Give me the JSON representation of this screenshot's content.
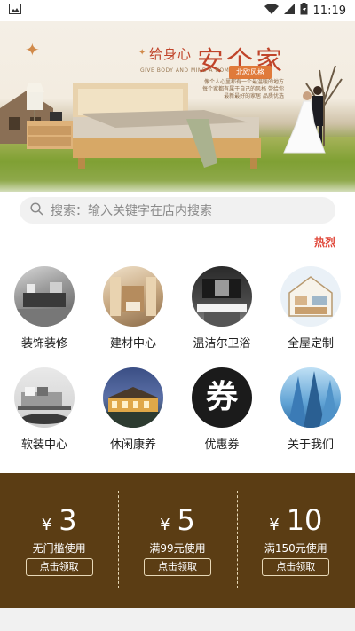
{
  "status_bar": {
    "time": "11:19"
  },
  "banner": {
    "title_prefix": "给身心",
    "title_main": "安个家",
    "subtitle": "GIVE BODY AND MIND A HOME",
    "tag": "北欧风格",
    "desc": "像个人心里都有一个最温暖的地方 每个家都有属于自己的风格 带给你最新最好的家居 品质优选"
  },
  "search": {
    "placeholder": "搜索：输入关键字在店内搜索"
  },
  "hot_label": "热烈",
  "categories": [
    {
      "label": "装饰装修",
      "icon": "decoration-icon"
    },
    {
      "label": "建材中心",
      "icon": "building-materials-icon"
    },
    {
      "label": "温洁尔卫浴",
      "icon": "bathroom-icon"
    },
    {
      "label": "全屋定制",
      "icon": "custom-home-icon"
    },
    {
      "label": "软装中心",
      "icon": "soft-furnishing-icon"
    },
    {
      "label": "休闲康养",
      "icon": "leisure-icon"
    },
    {
      "label": "优惠券",
      "icon": "coupon-icon",
      "glyph": "券"
    },
    {
      "label": "关于我们",
      "icon": "about-us-icon"
    }
  ],
  "coupons": [
    {
      "currency": "¥",
      "amount": "3",
      "condition": "无门槛使用",
      "button": "点击领取"
    },
    {
      "currency": "¥",
      "amount": "5",
      "condition": "满99元使用",
      "button": "点击领取"
    },
    {
      "currency": "¥",
      "amount": "10",
      "condition": "满150元使用",
      "button": "点击领取"
    }
  ],
  "colors": {
    "coupon_bg": "#5b3d14",
    "accent": "#c0442a",
    "hot": "#e0483a"
  }
}
